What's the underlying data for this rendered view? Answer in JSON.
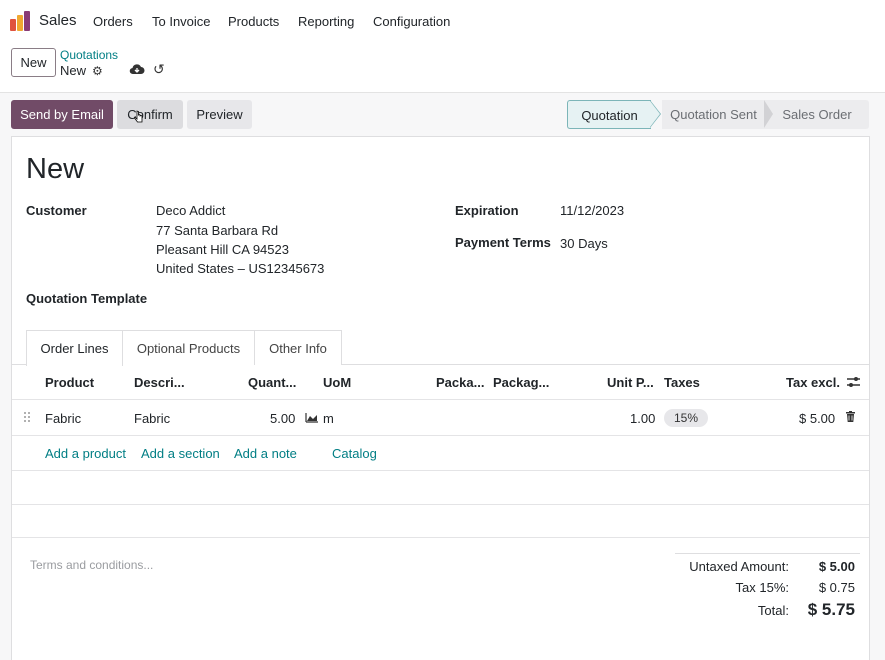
{
  "app": {
    "name": "Sales"
  },
  "nav": {
    "items": [
      "Orders",
      "To Invoice",
      "Products",
      "Reporting",
      "Configuration"
    ]
  },
  "control": {
    "new_label": "New",
    "breadcrumb_parent": "Quotations",
    "breadcrumb_current": "New"
  },
  "actions": {
    "send_email": "Send by Email",
    "confirm": "Confirm",
    "preview": "Preview"
  },
  "statusbar": {
    "stages": [
      "Quotation",
      "Quotation Sent",
      "Sales Order"
    ],
    "active": "Quotation"
  },
  "form": {
    "title": "New",
    "customer_label": "Customer",
    "customer_lines": [
      "Deco Addict",
      "77 Santa Barbara Rd",
      "Pleasant Hill CA 94523",
      "United States – US12345673"
    ],
    "expiration_label": "Expiration",
    "expiration_value": "11/12/2023",
    "payment_terms_label": "Payment Terms",
    "payment_terms_value": "30 Days",
    "template_label": "Quotation Template"
  },
  "tabs": [
    "Order Lines",
    "Optional Products",
    "Other Info"
  ],
  "table": {
    "columns": [
      "Product",
      "Descri...",
      "Quant...",
      "UoM",
      "Packa...",
      "Packag...",
      "Unit P...",
      "Taxes",
      "Tax excl."
    ],
    "rows": [
      {
        "product": "Fabric",
        "description": "Fabric",
        "quantity": "5.00",
        "uom": "m",
        "unit_price": "1.00",
        "tax": "15%",
        "subtotal": "$ 5.00"
      }
    ],
    "add_links": [
      "Add a product",
      "Add a section",
      "Add a note",
      "Catalog"
    ]
  },
  "terms_placeholder": "Terms and conditions...",
  "totals": {
    "untaxed_label": "Untaxed Amount:",
    "untaxed_value": "$ 5.00",
    "tax_label": "Tax 15%:",
    "tax_value": "$ 0.75",
    "total_label": "Total:",
    "total_value": "$ 5.75"
  },
  "colors": {
    "primary": "#714b67",
    "link": "#017e84"
  }
}
